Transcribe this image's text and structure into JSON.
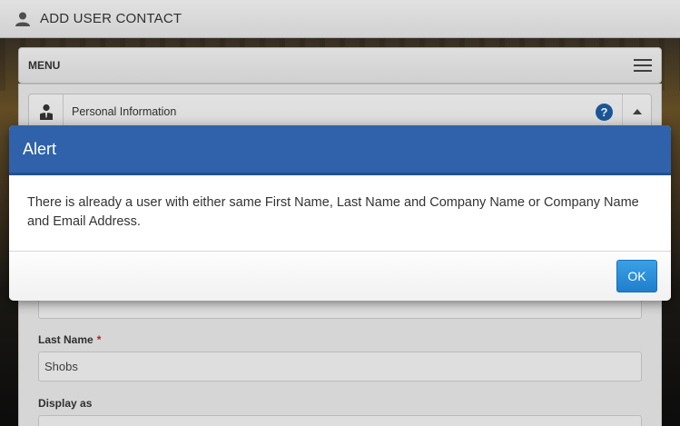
{
  "header": {
    "title": "ADD USER CONTACT",
    "icon": "user-icon"
  },
  "menu": {
    "label": "MENU",
    "icon": "hamburger-icon"
  },
  "section": {
    "title": "Personal Information",
    "help_icon": "?",
    "collapse_icon": "chevron-up-icon"
  },
  "form": {
    "first_name_value": "",
    "last_name_label": "Last Name",
    "last_name_required": "*",
    "last_name_value": "Shobs",
    "display_as_label": "Display as",
    "display_as_value": ""
  },
  "dialog": {
    "title": "Alert",
    "message": "There is already a user with either same First Name, Last Name and Company Name or Company Name and Email Address.",
    "ok_label": "OK"
  },
  "colors": {
    "dialog_header": "#2f62aa",
    "ok_button": "#2b8fd8",
    "help_icon": "#1d5ea3"
  }
}
